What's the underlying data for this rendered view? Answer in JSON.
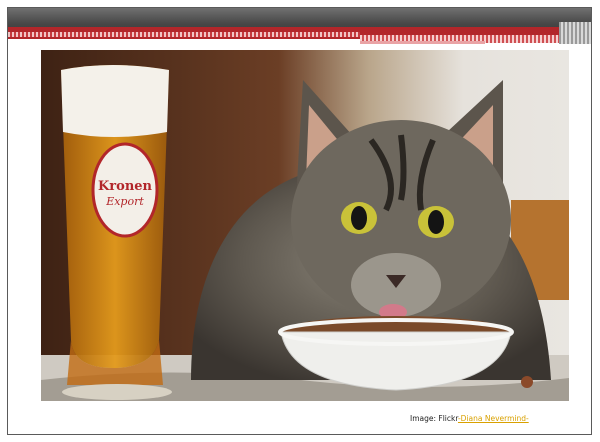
{
  "caption": {
    "prefix": "Image:  Flickr",
    "link_text": "-Diana Nevermind-"
  },
  "glass_brand": {
    "line1": "Kronen",
    "line2": "Export"
  },
  "colors": {
    "header_gray": "#474747",
    "accent_red": "#b2262a",
    "link_gold": "#d9a100"
  }
}
